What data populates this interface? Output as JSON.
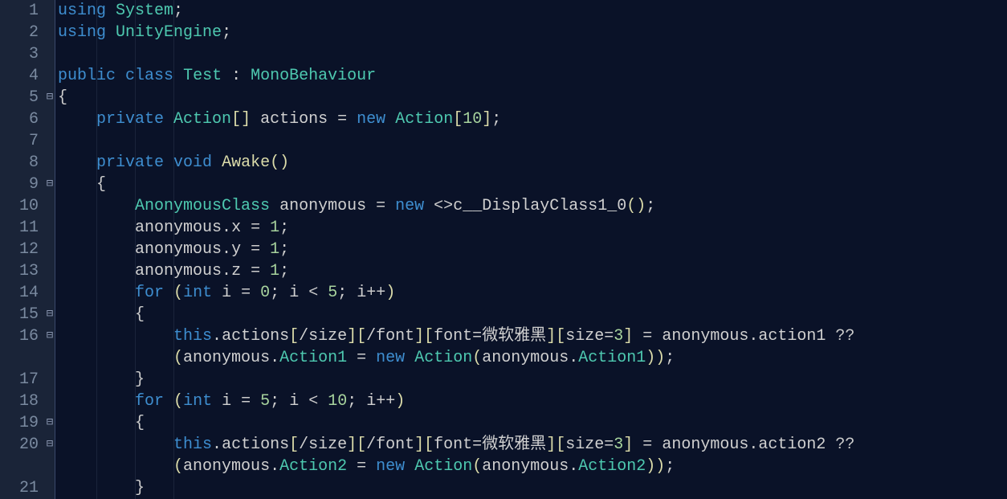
{
  "gutter": {
    "start": 1,
    "end": 21
  },
  "fold_markers": {
    "5": "⊟",
    "9": "⊟",
    "15": "⊟",
    "16": "⊟",
    "19": "⊟",
    "20": "⊟"
  },
  "code": {
    "l1": [
      [
        "kw-blue",
        "using"
      ],
      [
        "punct",
        " "
      ],
      [
        "type",
        "System"
      ],
      [
        "punct",
        ";"
      ]
    ],
    "l2": [
      [
        "kw-blue",
        "using"
      ],
      [
        "punct",
        " "
      ],
      [
        "type",
        "UnityEngine"
      ],
      [
        "punct",
        ";"
      ]
    ],
    "l3": [],
    "l4": [
      [
        "kw-blue",
        "public"
      ],
      [
        "punct",
        " "
      ],
      [
        "kw-blue",
        "class"
      ],
      [
        "punct",
        " "
      ],
      [
        "type",
        "Test"
      ],
      [
        "punct",
        " "
      ],
      [
        "punct",
        ":"
      ],
      [
        "punct",
        " "
      ],
      [
        "type",
        "MonoBehaviour"
      ]
    ],
    "l5": [
      [
        "brace",
        "{"
      ]
    ],
    "l6": [
      [
        "punct",
        "    "
      ],
      [
        "kw-blue",
        "private"
      ],
      [
        "punct",
        " "
      ],
      [
        "type",
        "Action"
      ],
      [
        "bracket",
        "[]"
      ],
      [
        "punct",
        " "
      ],
      [
        "ident",
        "actions"
      ],
      [
        "punct",
        " "
      ],
      [
        "op",
        "="
      ],
      [
        "punct",
        " "
      ],
      [
        "kw-blue",
        "new"
      ],
      [
        "punct",
        " "
      ],
      [
        "type",
        "Action"
      ],
      [
        "bracket",
        "["
      ],
      [
        "num",
        "10"
      ],
      [
        "bracket",
        "]"
      ],
      [
        "punct",
        ";"
      ]
    ],
    "l7": [],
    "l8": [
      [
        "punct",
        "    "
      ],
      [
        "kw-blue",
        "private"
      ],
      [
        "punct",
        " "
      ],
      [
        "kw-blue",
        "void"
      ],
      [
        "punct",
        " "
      ],
      [
        "method",
        "Awake"
      ],
      [
        "bracket",
        "()"
      ]
    ],
    "l9": [
      [
        "punct",
        "    "
      ],
      [
        "brace",
        "{"
      ]
    ],
    "l10": [
      [
        "punct",
        "        "
      ],
      [
        "type",
        "AnonymousClass"
      ],
      [
        "punct",
        " "
      ],
      [
        "ident",
        "anonymous"
      ],
      [
        "punct",
        " "
      ],
      [
        "op",
        "="
      ],
      [
        "punct",
        " "
      ],
      [
        "kw-blue",
        "new"
      ],
      [
        "punct",
        " "
      ],
      [
        "op",
        "<>"
      ],
      [
        "ident",
        "c__DisplayClass1_0"
      ],
      [
        "bracket",
        "()"
      ],
      [
        "punct",
        ";"
      ]
    ],
    "l11": [
      [
        "punct",
        "        "
      ],
      [
        "ident",
        "anonymous"
      ],
      [
        "punct",
        "."
      ],
      [
        "ident",
        "x"
      ],
      [
        "punct",
        " "
      ],
      [
        "op",
        "="
      ],
      [
        "punct",
        " "
      ],
      [
        "num",
        "1"
      ],
      [
        "punct",
        ";"
      ]
    ],
    "l12": [
      [
        "punct",
        "        "
      ],
      [
        "ident",
        "anonymous"
      ],
      [
        "punct",
        "."
      ],
      [
        "ident",
        "y"
      ],
      [
        "punct",
        " "
      ],
      [
        "op",
        "="
      ],
      [
        "punct",
        " "
      ],
      [
        "num",
        "1"
      ],
      [
        "punct",
        ";"
      ]
    ],
    "l13": [
      [
        "punct",
        "        "
      ],
      [
        "ident",
        "anonymous"
      ],
      [
        "punct",
        "."
      ],
      [
        "ident",
        "z"
      ],
      [
        "punct",
        " "
      ],
      [
        "op",
        "="
      ],
      [
        "punct",
        " "
      ],
      [
        "num",
        "1"
      ],
      [
        "punct",
        ";"
      ]
    ],
    "l14": [
      [
        "punct",
        "        "
      ],
      [
        "kw-blue",
        "for"
      ],
      [
        "punct",
        " "
      ],
      [
        "bracket",
        "("
      ],
      [
        "kw-blue",
        "int"
      ],
      [
        "punct",
        " "
      ],
      [
        "ident",
        "i"
      ],
      [
        "punct",
        " "
      ],
      [
        "op",
        "="
      ],
      [
        "punct",
        " "
      ],
      [
        "num",
        "0"
      ],
      [
        "punct",
        "; "
      ],
      [
        "ident",
        "i"
      ],
      [
        "punct",
        " "
      ],
      [
        "op",
        "<"
      ],
      [
        "punct",
        " "
      ],
      [
        "num",
        "5"
      ],
      [
        "punct",
        "; "
      ],
      [
        "ident",
        "i"
      ],
      [
        "op",
        "++"
      ],
      [
        "bracket",
        ")"
      ]
    ],
    "l15": [
      [
        "punct",
        "        "
      ],
      [
        "brace",
        "{"
      ]
    ],
    "l16": [
      [
        "punct",
        "            "
      ],
      [
        "kw-blue",
        "this"
      ],
      [
        "punct",
        "."
      ],
      [
        "ident",
        "actions"
      ],
      [
        "bracket",
        "["
      ],
      [
        "ident",
        "/size"
      ],
      [
        "bracket",
        "]["
      ],
      [
        "ident",
        "/font"
      ],
      [
        "bracket",
        "]["
      ],
      [
        "ident",
        "font"
      ],
      [
        "op",
        "="
      ],
      [
        "ident",
        "微软雅黑"
      ],
      [
        "bracket",
        "]["
      ],
      [
        "ident",
        "size"
      ],
      [
        "op",
        "="
      ],
      [
        "num",
        "3"
      ],
      [
        "bracket",
        "]"
      ],
      [
        "punct",
        " "
      ],
      [
        "op",
        "="
      ],
      [
        "punct",
        " "
      ],
      [
        "ident",
        "anonymous"
      ],
      [
        "punct",
        "."
      ],
      [
        "ident",
        "action1"
      ],
      [
        "punct",
        " "
      ],
      [
        "op",
        "??"
      ]
    ],
    "l16b": [
      [
        "punct",
        "            "
      ],
      [
        "bracket",
        "("
      ],
      [
        "ident",
        "anonymous"
      ],
      [
        "punct",
        "."
      ],
      [
        "member2",
        "Action1"
      ],
      [
        "punct",
        " "
      ],
      [
        "op",
        "="
      ],
      [
        "punct",
        " "
      ],
      [
        "kw-blue",
        "new"
      ],
      [
        "punct",
        " "
      ],
      [
        "type",
        "Action"
      ],
      [
        "bracket",
        "("
      ],
      [
        "ident",
        "anonymous"
      ],
      [
        "punct",
        "."
      ],
      [
        "member2",
        "Action1"
      ],
      [
        "bracket",
        "))"
      ],
      [
        "punct",
        ";"
      ]
    ],
    "l17": [
      [
        "punct",
        "        "
      ],
      [
        "brace",
        "}"
      ]
    ],
    "l18": [
      [
        "punct",
        "        "
      ],
      [
        "kw-blue",
        "for"
      ],
      [
        "punct",
        " "
      ],
      [
        "bracket",
        "("
      ],
      [
        "kw-blue",
        "int"
      ],
      [
        "punct",
        " "
      ],
      [
        "ident",
        "i"
      ],
      [
        "punct",
        " "
      ],
      [
        "op",
        "="
      ],
      [
        "punct",
        " "
      ],
      [
        "num",
        "5"
      ],
      [
        "punct",
        "; "
      ],
      [
        "ident",
        "i"
      ],
      [
        "punct",
        " "
      ],
      [
        "op",
        "<"
      ],
      [
        "punct",
        " "
      ],
      [
        "num",
        "10"
      ],
      [
        "punct",
        "; "
      ],
      [
        "ident",
        "i"
      ],
      [
        "op",
        "++"
      ],
      [
        "bracket",
        ")"
      ]
    ],
    "l19": [
      [
        "punct",
        "        "
      ],
      [
        "brace",
        "{"
      ]
    ],
    "l20": [
      [
        "punct",
        "            "
      ],
      [
        "kw-blue",
        "this"
      ],
      [
        "punct",
        "."
      ],
      [
        "ident",
        "actions"
      ],
      [
        "bracket",
        "["
      ],
      [
        "ident",
        "/size"
      ],
      [
        "bracket",
        "]["
      ],
      [
        "ident",
        "/font"
      ],
      [
        "bracket",
        "]["
      ],
      [
        "ident",
        "font"
      ],
      [
        "op",
        "="
      ],
      [
        "ident",
        "微软雅黑"
      ],
      [
        "bracket",
        "]["
      ],
      [
        "ident",
        "size"
      ],
      [
        "op",
        "="
      ],
      [
        "num",
        "3"
      ],
      [
        "bracket",
        "]"
      ],
      [
        "punct",
        " "
      ],
      [
        "op",
        "="
      ],
      [
        "punct",
        " "
      ],
      [
        "ident",
        "anonymous"
      ],
      [
        "punct",
        "."
      ],
      [
        "ident",
        "action2"
      ],
      [
        "punct",
        " "
      ],
      [
        "op",
        "??"
      ]
    ],
    "l20b": [
      [
        "punct",
        "            "
      ],
      [
        "bracket",
        "("
      ],
      [
        "ident",
        "anonymous"
      ],
      [
        "punct",
        "."
      ],
      [
        "member2",
        "Action2"
      ],
      [
        "punct",
        " "
      ],
      [
        "op",
        "="
      ],
      [
        "punct",
        " "
      ],
      [
        "kw-blue",
        "new"
      ],
      [
        "punct",
        " "
      ],
      [
        "type",
        "Action"
      ],
      [
        "bracket",
        "("
      ],
      [
        "ident",
        "anonymous"
      ],
      [
        "punct",
        "."
      ],
      [
        "member2",
        "Action2"
      ],
      [
        "bracket",
        "))"
      ],
      [
        "punct",
        ";"
      ]
    ],
    "l21": [
      [
        "punct",
        "        "
      ],
      [
        "brace",
        "}"
      ]
    ]
  },
  "line_keys": [
    "l1",
    "l2",
    "l3",
    "l4",
    "l5",
    "l6",
    "l7",
    "l8",
    "l9",
    "l10",
    "l11",
    "l12",
    "l13",
    "l14",
    "l15",
    "l16",
    "l16b",
    "l17",
    "l18",
    "l19",
    "l20",
    "l20b",
    "l21"
  ],
  "physical_to_gutter": {
    "l1": "1",
    "l2": "2",
    "l3": "3",
    "l4": "4",
    "l5": "5",
    "l6": "6",
    "l7": "7",
    "l8": "8",
    "l9": "9",
    "l10": "10",
    "l11": "11",
    "l12": "12",
    "l13": "13",
    "l14": "14",
    "l15": "15",
    "l16": "16",
    "l16b": "",
    "l17": "17",
    "l18": "18",
    "l19": "19",
    "l20": "20",
    "l20b": "",
    "l21": "21"
  }
}
